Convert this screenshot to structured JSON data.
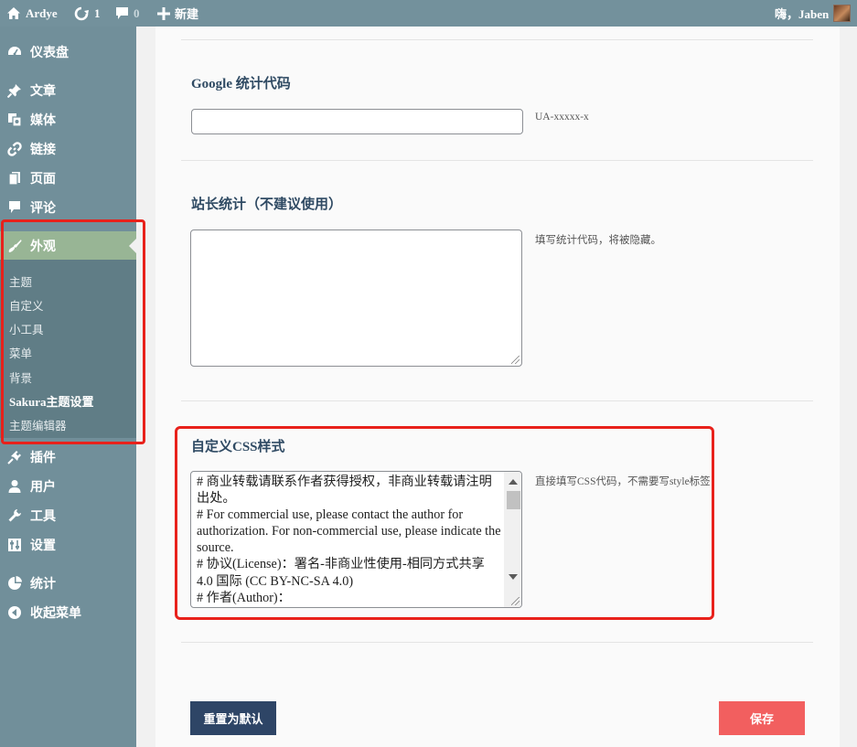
{
  "topbar": {
    "site_name": "Ardye",
    "updates_count": "1",
    "comments_count": "0",
    "new_label": "新建",
    "greeting": "嗨，Jaben"
  },
  "sidebar": {
    "items": [
      {
        "label": "仪表盘",
        "icon": "dashboard-icon"
      },
      {
        "label": "文章",
        "icon": "pin-icon"
      },
      {
        "label": "媒体",
        "icon": "media-icon"
      },
      {
        "label": "链接",
        "icon": "link-icon"
      },
      {
        "label": "页面",
        "icon": "page-icon"
      },
      {
        "label": "评论",
        "icon": "comment-icon"
      },
      {
        "label": "外观",
        "icon": "appearance-icon"
      },
      {
        "label": "插件",
        "icon": "plugin-icon"
      },
      {
        "label": "用户",
        "icon": "user-icon"
      },
      {
        "label": "工具",
        "icon": "wrench-icon"
      },
      {
        "label": "设置",
        "icon": "settings-icon"
      },
      {
        "label": "统计",
        "icon": "stats-icon"
      },
      {
        "label": "收起菜单",
        "icon": "collapse-icon"
      }
    ],
    "submenu": [
      "主题",
      "自定义",
      "小工具",
      "菜单",
      "背景",
      "Sakura主题设置",
      "主题编辑器"
    ],
    "active_item": "外观",
    "current_submenu": "Sakura主题设置"
  },
  "main": {
    "google": {
      "title": "Google 统计代码",
      "value": "",
      "description": "UA-xxxxx-x"
    },
    "site_stats": {
      "title": "站长统计（不建议使用）",
      "value": "",
      "description": "填写统计代码，将被隐藏。"
    },
    "custom_css": {
      "title": "自定义CSS样式",
      "value": "# 商业转载请联系作者获得授权，非商业转载请注明出处。\n# For commercial use, please contact the author for authorization. For non-commercial use, please indicate the source.\n# 协议(License)：署名-非商业性使用-相同方式共享 4.0 国际 (CC BY-NC-SA 4.0)\n# 作者(Author)：",
      "description": "直接填写CSS代码，不需要写style标签"
    },
    "reset_label": "重置为默认",
    "save_label": "保存"
  },
  "colors": {
    "topbar": "#73919c",
    "sidebar": "#718f9a",
    "submenu": "#607d86",
    "active": "#98b595",
    "reset_button": "#2e4566",
    "save_button": "#f25f5f",
    "highlight": "#e8211b"
  }
}
